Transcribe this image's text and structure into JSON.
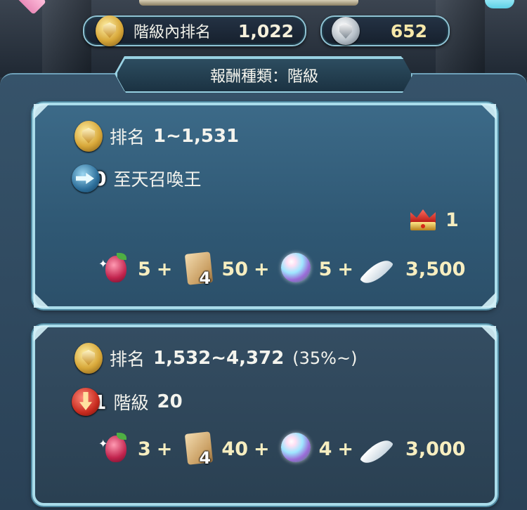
{
  "header": {
    "rank_label": "階級內排名",
    "rank_value": "1,022",
    "silver_value": "652"
  },
  "tab": {
    "label": "報酬種類：階級"
  },
  "tiers": [
    {
      "rank_prefix": "排名",
      "rank_range": "1~1,531",
      "rank_pct": "",
      "status_number": "0",
      "status_text": "至天召喚王",
      "crown_count": "1",
      "rewards": {
        "fruit": "5",
        "scroll_badge": "4",
        "scroll": "50",
        "orb": "5",
        "feather": "3,500"
      }
    },
    {
      "rank_prefix": "排名",
      "rank_range": "1,532~4,372",
      "rank_pct": "(35%~)",
      "status_number": "1",
      "status_label": "階級",
      "status_value": "20",
      "rewards": {
        "fruit": "3",
        "scroll_badge": "4",
        "scroll": "40",
        "orb": "4",
        "feather": "3,000"
      }
    }
  ],
  "plus_sign": "+",
  "icons": [
    "rank-medal-icon",
    "silver-medal-icon",
    "promote-arrow-icon",
    "demote-arrow-icon",
    "crown-icon",
    "fruit-icon",
    "scroll-icon",
    "orb-icon",
    "feather-icon"
  ]
}
